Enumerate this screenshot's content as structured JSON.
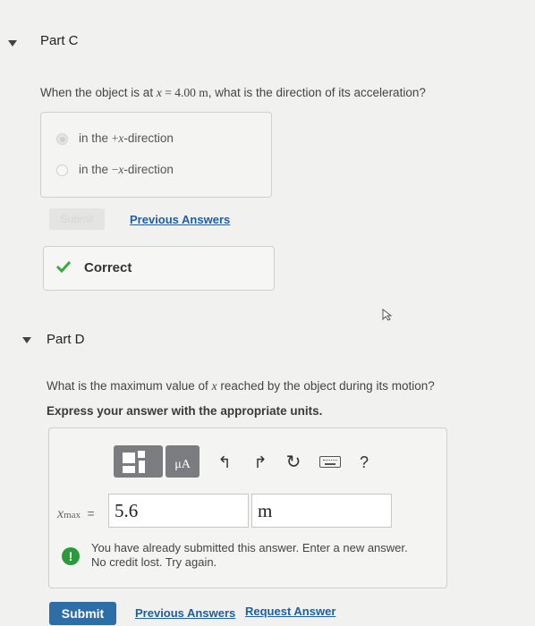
{
  "partC": {
    "title": "Part C",
    "question_prefix": "When the object is at ",
    "question_var": "x",
    "question_mid": " = 4.00 ",
    "question_unit": "m",
    "question_suffix": ", what is the direction of its acceleration?",
    "options": [
      {
        "prefix": "in the ",
        "sign": "+",
        "var": "x",
        "suffix": "-direction",
        "selected": true
      },
      {
        "prefix": "in the ",
        "sign": "−",
        "var": "x",
        "suffix": "-direction",
        "selected": false
      }
    ],
    "submit_label": "Submit",
    "previous_answers_label": "Previous Answers",
    "feedback": "Correct"
  },
  "partD": {
    "title": "Part D",
    "question_prefix": "What is the maximum value of ",
    "question_var": "x",
    "question_suffix": " reached by the object during its motion?",
    "instruction": "Express your answer with the appropriate units.",
    "toolbar": {
      "templates_icon": "templates-icon",
      "units_label": "μA",
      "undo_icon": "undo-icon",
      "redo_icon": "redo-icon",
      "reset_icon": "reset-icon",
      "keyboard_icon": "keyboard-icon",
      "help_label": "?"
    },
    "var_label": "x",
    "var_sub": "max",
    "equals": "=",
    "value": "5.6",
    "units": "m",
    "warning_line1": "You have already submitted this answer. Enter a new answer.",
    "warning_line2": "No credit lost. Try again.",
    "submit_label": "Submit",
    "previous_answers_label": "Previous Answers",
    "request_answer_label": "Request Answer"
  },
  "colors": {
    "accent": "#2e6ea6",
    "correct": "#3aa83a",
    "warning": "#2a9a3c"
  }
}
